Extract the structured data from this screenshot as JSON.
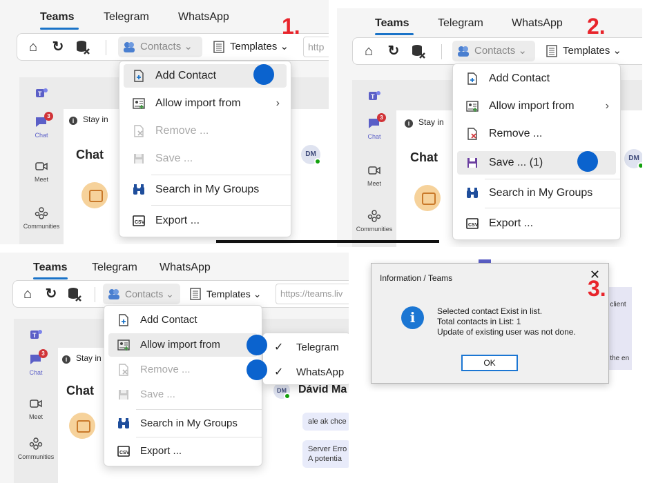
{
  "tabs": [
    "Teams",
    "Telegram",
    "WhatsApp"
  ],
  "toolbar": {
    "contacts_label": "Contacts",
    "templates_label": "Templates",
    "url_short": "http",
    "url_full": "https://teams.liv"
  },
  "rail": {
    "chat": "Chat",
    "meet": "Meet",
    "communities": "Communities",
    "badge": "3"
  },
  "content": {
    "stay": "Stay in",
    "chat_heading": "Chat",
    "dm_initials": "DM",
    "contact_name": "Dávid Ma"
  },
  "menu": {
    "add_contact": "Add Contact",
    "allow_import": "Allow import from",
    "remove": "Remove ...",
    "save": "Save ...",
    "save_count": "Save ... (1)",
    "search_groups": "Search in My Groups",
    "export": "Export ..."
  },
  "submenu": [
    "Telegram",
    "WhatsApp"
  ],
  "steps": [
    "1.",
    "2.",
    "3."
  ],
  "dialog": {
    "title": "Information / Teams",
    "line1": "Selected contact Exist in list.",
    "line2": "Total contacts in List: 1",
    "line3": "Update of existing user was not done.",
    "ok": "OK",
    "bg_right1": "e client",
    "bg_right2": ")",
    "bg_right3": "d the en"
  },
  "messages": {
    "m1": "ale ak chce",
    "m2a": "Server Erro",
    "m2b": "A potentia"
  },
  "colors": {
    "accent": "#1a73c8",
    "marker": "#0b63ce",
    "step": "#e8242b",
    "teams_purple": "#5b5fc7"
  },
  "icons": [
    "home-icon",
    "refresh-icon",
    "database-x-icon",
    "contacts-icon",
    "templates-icon",
    "add-contact-icon",
    "import-icon",
    "remove-icon",
    "save-icon",
    "search-binoculars-icon",
    "export-csv-icon",
    "info-icon",
    "close-icon",
    "check-icon",
    "chevron-right-icon"
  ]
}
